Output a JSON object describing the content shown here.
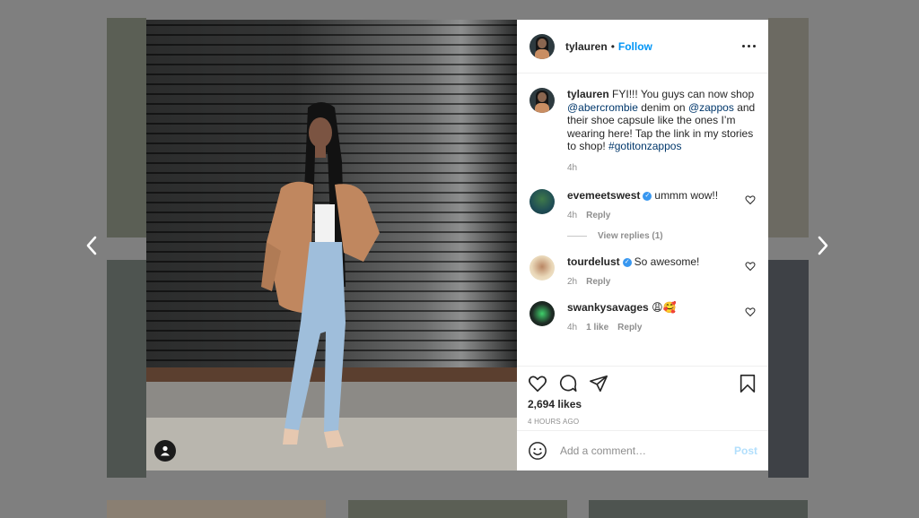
{
  "post": {
    "username": "tylauren",
    "follow_label": "Follow",
    "dot": "•",
    "caption": {
      "username": "tylauren",
      "parts": [
        "FYI!!! You guys can now shop",
        "@abercrombie",
        "denim on",
        "@zappos",
        "and their shoe capsule like the ones I’m wearing here! Tap the link in my stories to shop!",
        "#gotitonzappos"
      ],
      "time": "4h"
    },
    "comments": [
      {
        "username": "evemeetswest",
        "verified": true,
        "text": "ummm wow!!",
        "time": "4h",
        "reply_label": "Reply",
        "view_replies": "View replies (1)"
      },
      {
        "username": "tourdelust",
        "verified": true,
        "text": "So awesome!",
        "time": "2h",
        "reply_label": "Reply"
      },
      {
        "username": "swankysavages",
        "verified": false,
        "text": "😩🥰",
        "time": "4h",
        "likes": "1 like",
        "reply_label": "Reply"
      }
    ],
    "likes": "2,694 likes",
    "posted": "4 HOURS AGO",
    "add_comment_placeholder": "Add a comment…",
    "post_label": "Post"
  },
  "colors": {
    "link": "#0095f6",
    "mention": "#00376b",
    "verified": "#3897f0",
    "post_disabled": "#b2dffc"
  },
  "icons": [
    "chevron-left-icon",
    "chevron-right-icon",
    "more-icon",
    "heart-icon",
    "comment-icon",
    "share-icon",
    "bookmark-icon",
    "emoji-icon",
    "user-tag-icon",
    "verified-icon"
  ]
}
